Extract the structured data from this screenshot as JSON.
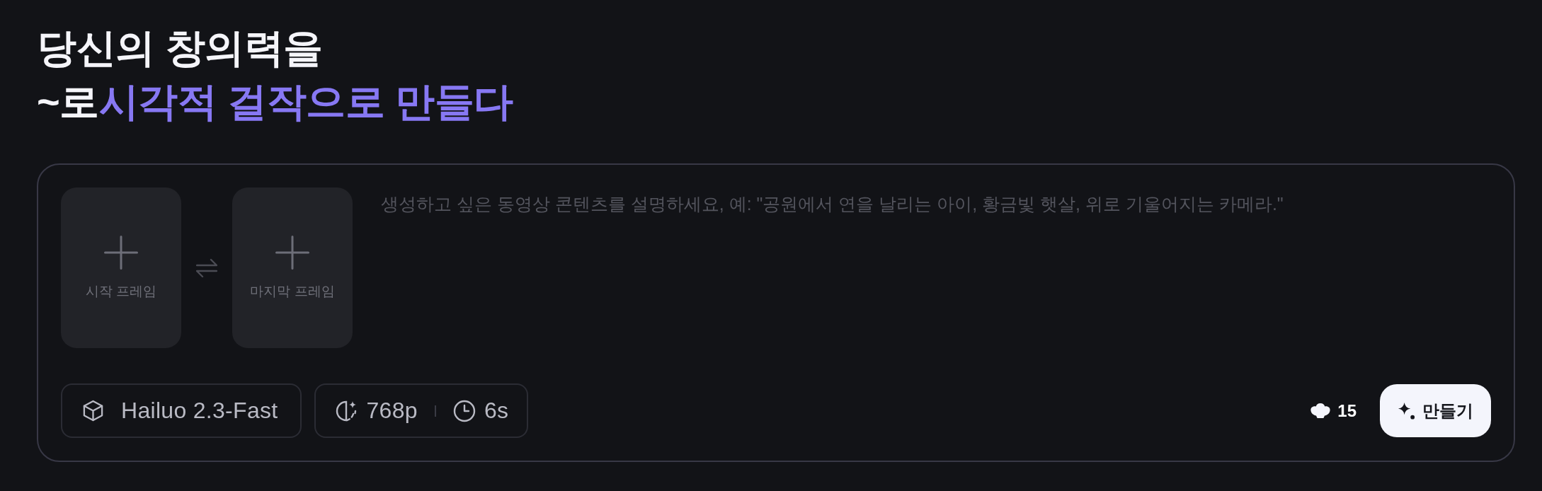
{
  "heading": {
    "lines": [
      {
        "segments": [
          {
            "text": "당신의 창의력을",
            "accent": false
          }
        ]
      },
      {
        "segments": [
          {
            "text": "~로",
            "accent": false
          },
          {
            "text": "시각적 걸작으로 만들다",
            "accent": true
          }
        ]
      }
    ]
  },
  "frames": [
    {
      "label": "시작 프레임"
    },
    {
      "label": "마지막 프레임"
    }
  ],
  "prompt": {
    "placeholder": "생성하고 싶은 동영상 콘텐츠를 설명하세요, 예: \"공원에서 연을 날리는 아이, 황금빛 햇살, 위로 기울어지는 카메라.\""
  },
  "model": {
    "label": "Hailuo 2.3-Fast"
  },
  "settings": {
    "resolution": "768p",
    "duration": "6s"
  },
  "credits": {
    "count": "15"
  },
  "create_button": {
    "label": "만들기"
  }
}
